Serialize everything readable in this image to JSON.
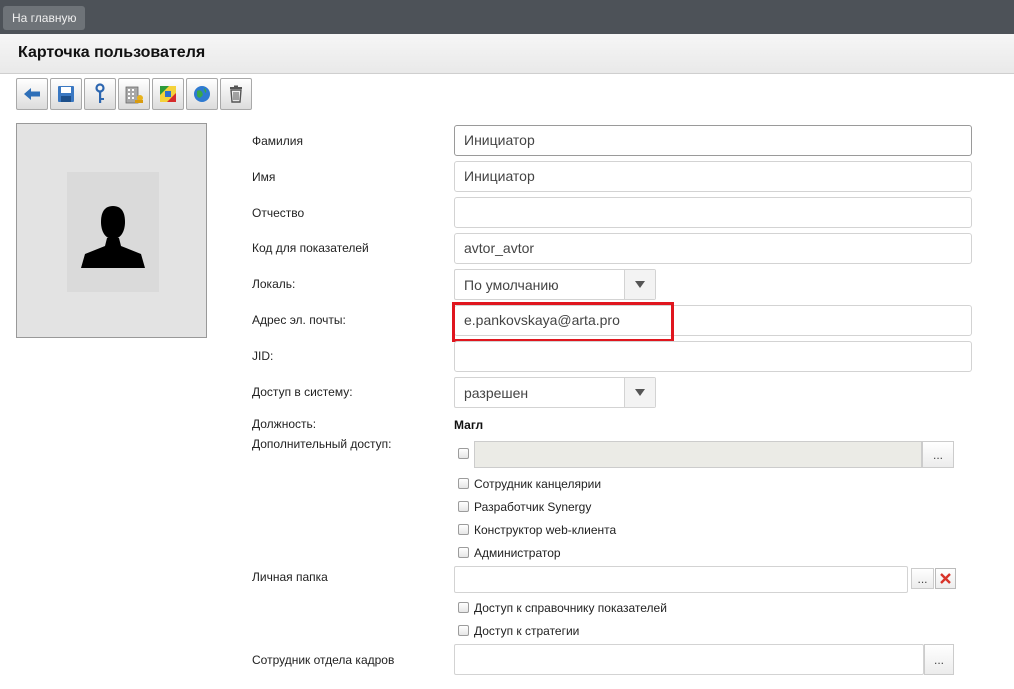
{
  "topbar": {
    "home_label": "На главную"
  },
  "header": {
    "title": "Карточка пользователя"
  },
  "toolbar": {
    "buttons": [
      "back-icon",
      "save-icon",
      "key-icon",
      "building-icon",
      "sync-icon",
      "globe-icon",
      "trash-icon"
    ]
  },
  "form": {
    "lastname": {
      "label": "Фамилия",
      "value": "Инициатор"
    },
    "firstname": {
      "label": "Имя",
      "value": "Инициатор"
    },
    "patronymic": {
      "label": "Отчество",
      "value": ""
    },
    "indicator_code": {
      "label": "Код для показателей",
      "value": "avtor_avtor"
    },
    "locale": {
      "label": "Локаль:",
      "value": "По умолчанию"
    },
    "email": {
      "label": "Адрес эл. почты:",
      "value": "e.pankovskaya@arta.pro"
    },
    "jid": {
      "label": "JID:",
      "value": ""
    },
    "access": {
      "label": "Доступ в систему:",
      "value": "разрешен"
    },
    "position": {
      "label": "Должность:",
      "value": "Магл"
    },
    "extra_access": {
      "label": "Дополнительный доступ:",
      "dots": "...",
      "options": [
        {
          "label": "Сотрудник канцелярии",
          "checked": false
        },
        {
          "label": "Разработчик Synergy",
          "checked": false
        },
        {
          "label": "Конструктор web-клиента",
          "checked": false
        },
        {
          "label": "Администратор",
          "checked": false
        }
      ]
    },
    "personal_folder": {
      "label": "Личная папка",
      "dots": "...",
      "options": [
        {
          "label": "Доступ к справочнику показателей",
          "checked": false
        },
        {
          "label": "Доступ к стратегии",
          "checked": false
        }
      ]
    },
    "hr_employee": {
      "label": "Сотрудник отдела кадров",
      "dots": "..."
    }
  },
  "colors": {
    "highlight": "#e0161e",
    "topbar": "#4d5258"
  }
}
